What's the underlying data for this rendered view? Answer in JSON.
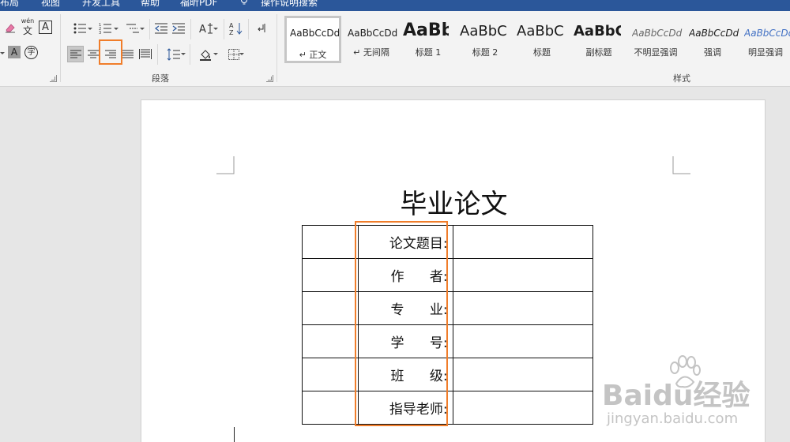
{
  "tabs": [
    "布局",
    "视图",
    "开发工具",
    "帮助",
    "福昕PDF",
    "操作说明搜索"
  ],
  "paragraph_group": {
    "label": "段落"
  },
  "styles_group": {
    "label": "样式",
    "items": [
      {
        "sample": "AaBbCcDd",
        "label": "↵ 正文",
        "selected": true
      },
      {
        "sample": "AaBbCcDd",
        "label": "↵ 无间隔",
        "selected": false
      },
      {
        "sample": "AaBb",
        "label": "标题 1",
        "selected": false
      },
      {
        "sample": "AaBbC",
        "label": "标题 2",
        "selected": false
      },
      {
        "sample": "AaBbC",
        "label": "标题",
        "selected": false
      },
      {
        "sample": "AaBbC",
        "label": "副标题",
        "selected": false
      },
      {
        "sample": "AaBbCcDd",
        "label": "不明显强调",
        "selected": false
      },
      {
        "sample": "AaBbCcDd",
        "label": "强调",
        "selected": false
      },
      {
        "sample": "AaBbCcDd",
        "label": "明显强调",
        "selected": false
      }
    ]
  },
  "font_group": {
    "phonetic_top": "wén",
    "phonetic_bottom": "文",
    "char_border": "A",
    "char_shading": "A",
    "enclosed_char": "字"
  },
  "document": {
    "title": "毕业论文",
    "rows": [
      {
        "label": "论文题目:"
      },
      {
        "label": "作      者:"
      },
      {
        "label": "专      业:"
      },
      {
        "label": "学      号:"
      },
      {
        "label": "班      级:"
      },
      {
        "label": "指导老师:"
      }
    ]
  },
  "watermark": {
    "brand": "Baidu经验",
    "url": "jingyan.baidu.com"
  },
  "colors": {
    "tab_bar": "#2b579a",
    "highlight": "#f07d2a",
    "ribbon": "#f3f3f3",
    "canvas": "#e6e6e6"
  }
}
